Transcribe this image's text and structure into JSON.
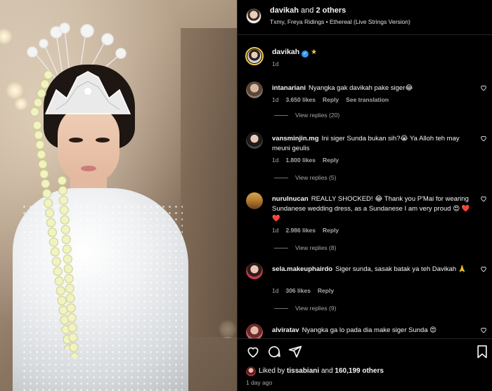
{
  "post": {
    "author": "davikah",
    "coauthors_text": "and",
    "coauthors_count": "2 others",
    "audio": "Txmy, Freya Ridings • Ethereal (Live Strings Version)"
  },
  "caption": {
    "username": "davikah",
    "verified_icon": "verified-badge-icon",
    "star": "★",
    "time": "1d"
  },
  "comments": [
    {
      "username": "intanariani",
      "text": "Nyangka gak davikah pake siger😂",
      "time": "1d",
      "likes": "3.650 likes",
      "reply": "Reply",
      "extra": "See translation",
      "view_replies": "View replies (20)"
    },
    {
      "username": "vansminjin.mg",
      "text": "Ini siger Sunda bukan sih?😭 Ya Alloh teh may meuni geulis",
      "time": "1d",
      "likes": "1.800 likes",
      "reply": "Reply",
      "view_replies": "View replies (5)"
    },
    {
      "username": "nurulnucan",
      "text": "REALLY SHOCKED! 😂 Thank you P'Mai for wearing Sundanese wedding dress, as a Sundanese I am very proud 😍 ❤️ ❤️",
      "time": "1d",
      "likes": "2.986 likes",
      "reply": "Reply",
      "view_replies": "View replies (8)"
    },
    {
      "username": "sela.makeuphairdo",
      "text": "Siger sunda, sasak batak ya teh Davikah 🙏",
      "time": "1d",
      "likes": "306 likes",
      "reply": "Reply",
      "view_replies": "View replies (9)"
    },
    {
      "username": "alviratav",
      "text": "Nyangka ga lo pada dia make siger Sunda 😍"
    }
  ],
  "likes": {
    "prefix": "Liked by",
    "first_user": "tissabiani",
    "and": "and",
    "count": "160,199 others"
  },
  "time_ago": "1 day ago",
  "colors": {
    "background": "#000000",
    "text": "#f5f5f5",
    "muted": "#a8a8a8",
    "verified": "#3897f0",
    "divider": "#262626"
  }
}
